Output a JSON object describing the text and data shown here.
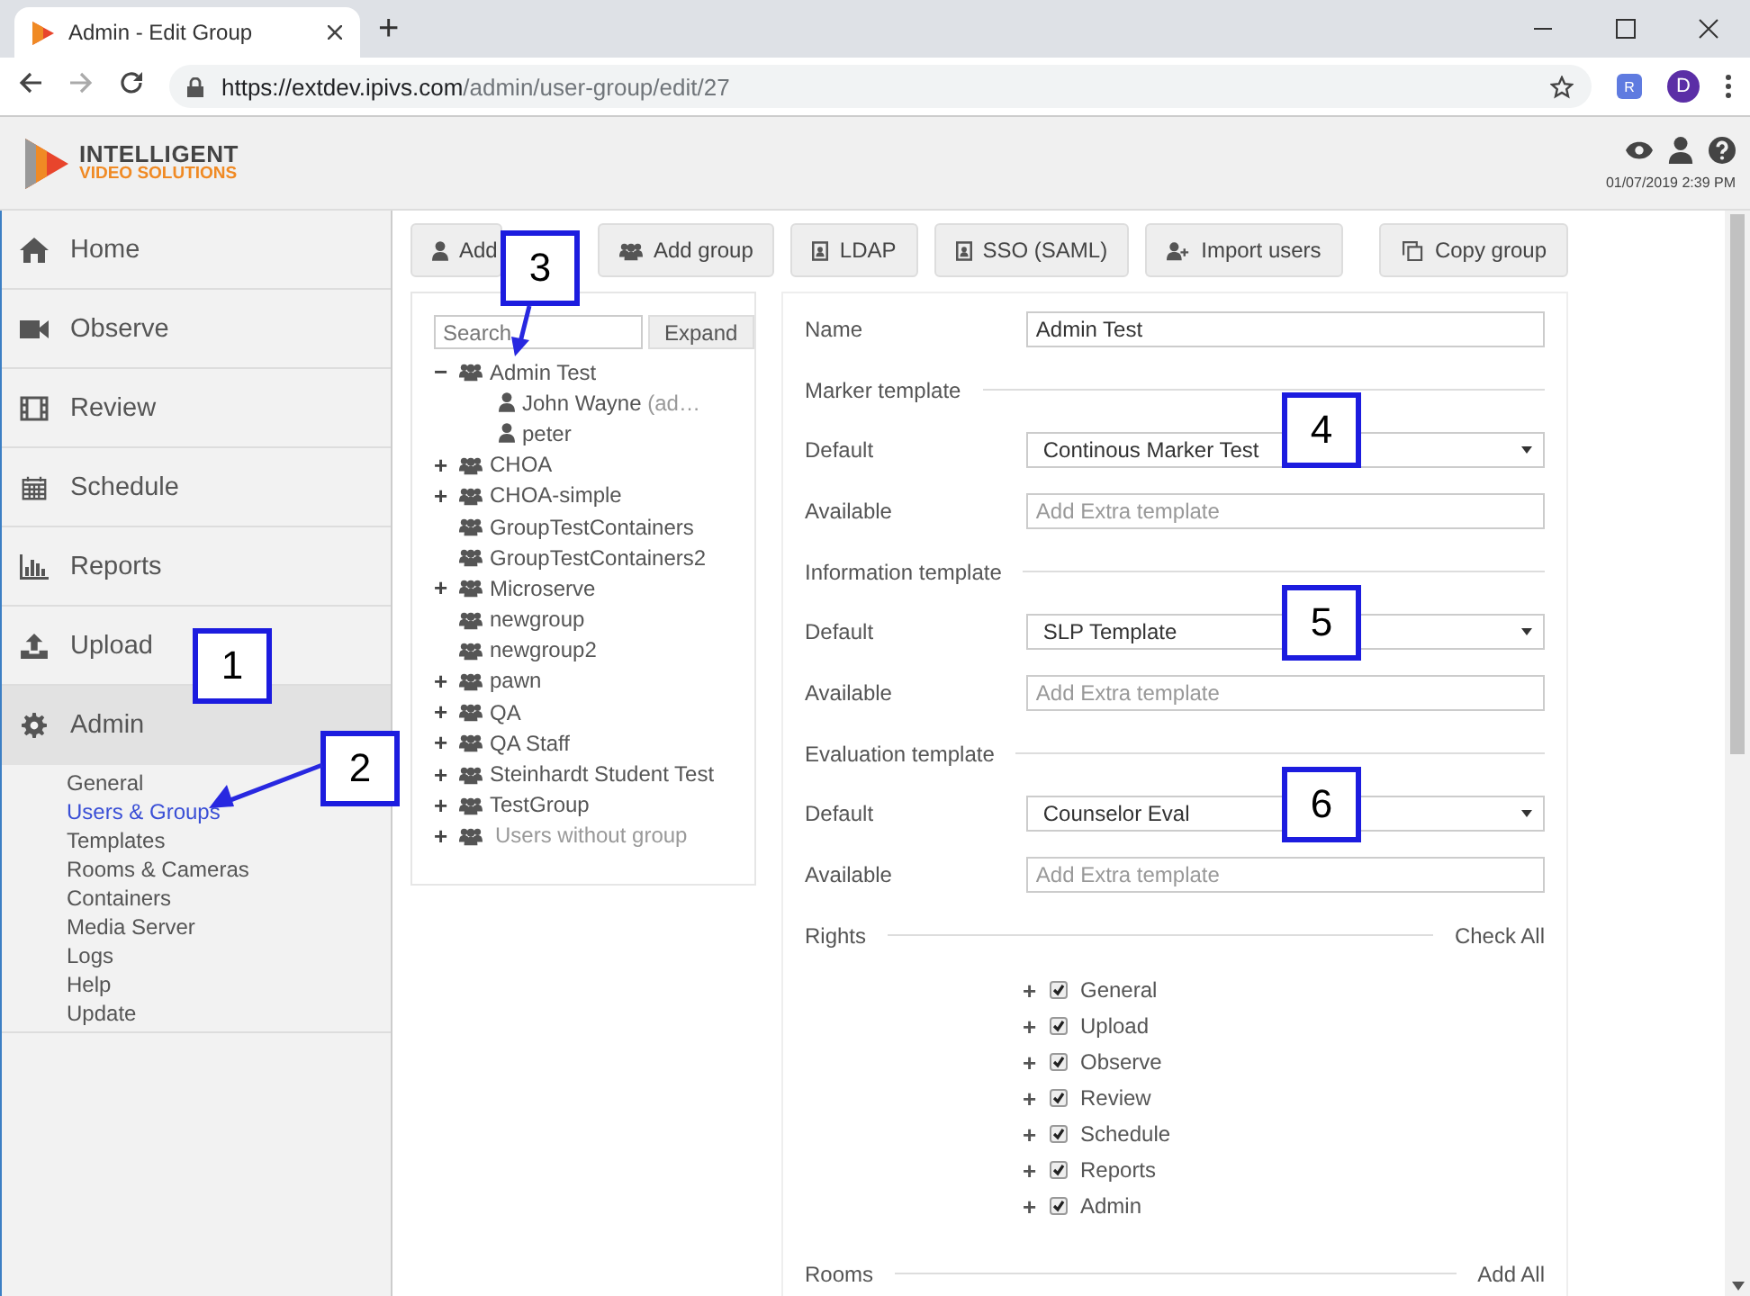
{
  "browser": {
    "tab_title": "Admin - Edit Group",
    "new_tab": "+",
    "url_host": "https://extdev.ipivs.com",
    "url_path": "/admin/user-group/edit/27",
    "extension_label": "R",
    "profile_initial": "D"
  },
  "header": {
    "logo_line1": "INTELLIGENT",
    "logo_line2": "VIDEO SOLUTIONS",
    "datetime": "01/07/2019 2:39 PM"
  },
  "sidebar": {
    "items": [
      {
        "label": "Home",
        "selected": false
      },
      {
        "label": "Observe",
        "selected": false
      },
      {
        "label": "Review",
        "selected": false
      },
      {
        "label": "Schedule",
        "selected": false
      },
      {
        "label": "Reports",
        "selected": false
      },
      {
        "label": "Upload",
        "selected": false
      },
      {
        "label": "Admin",
        "selected": true
      }
    ],
    "subitems": [
      {
        "label": "General",
        "selected": false
      },
      {
        "label": "Users & Groups",
        "selected": true
      },
      {
        "label": "Templates",
        "selected": false
      },
      {
        "label": "Rooms & Cameras",
        "selected": false
      },
      {
        "label": "Containers",
        "selected": false
      },
      {
        "label": "Media Server",
        "selected": false
      },
      {
        "label": "Logs",
        "selected": false
      },
      {
        "label": "Help",
        "selected": false
      },
      {
        "label": "Update",
        "selected": false
      }
    ]
  },
  "toolbar": {
    "buttons": [
      {
        "label": "Add"
      },
      {
        "label": "Add group"
      },
      {
        "label": "LDAP"
      },
      {
        "label": "SSO (SAML)"
      },
      {
        "label": "Import users"
      }
    ],
    "copy_button": {
      "label": "Copy group"
    }
  },
  "tree": {
    "search": {
      "placeholder": "Search"
    },
    "expand_button": "Expand",
    "nodes": [
      {
        "label": "Admin Test",
        "toggle": "−",
        "muted": false,
        "children": [
          {
            "label": "John Wayne",
            "note": "(ad…"
          },
          {
            "label": "peter"
          }
        ]
      },
      {
        "label": "CHOA",
        "toggle": "+",
        "muted": false
      },
      {
        "label": "CHOA-simple",
        "toggle": "+",
        "muted": false
      },
      {
        "label": "GroupTestContainers",
        "muted": false
      },
      {
        "label": "GroupTestContainers2",
        "muted": false
      },
      {
        "label": "Microserve",
        "toggle": "+",
        "muted": false
      },
      {
        "label": "newgroup",
        "muted": false
      },
      {
        "label": "newgroup2",
        "muted": false
      },
      {
        "label": "pawn",
        "toggle": "+",
        "muted": false
      },
      {
        "label": "QA",
        "toggle": "+",
        "muted": false
      },
      {
        "label": "QA Staff",
        "toggle": "+",
        "muted": false
      },
      {
        "label": "Steinhardt Student Test",
        "toggle": "+",
        "muted": false
      },
      {
        "label": "TestGroup",
        "toggle": "+",
        "muted": false
      },
      {
        "label": "Users without group",
        "toggle": "+",
        "muted": true
      }
    ]
  },
  "form": {
    "name_label": "Name",
    "name_value": "Admin Test",
    "templates": [
      {
        "title": "Marker template",
        "default_label": "Default",
        "default_value": "Continous Marker Test",
        "available_label": "Available",
        "available_placeholder": "Add Extra template"
      },
      {
        "title": "Information template",
        "default_label": "Default",
        "default_value": "SLP Template",
        "available_label": "Available",
        "available_placeholder": "Add Extra template"
      },
      {
        "title": "Evaluation template",
        "default_label": "Default",
        "default_value": "Counselor Eval",
        "available_label": "Available",
        "available_placeholder": "Add Extra template"
      }
    ],
    "rights": {
      "title": "Rights",
      "action": "Check All",
      "items": [
        {
          "toggle": "+",
          "label": "General",
          "checked": true
        },
        {
          "toggle": "+",
          "label": "Upload",
          "checked": true
        },
        {
          "toggle": "+",
          "label": "Observe",
          "checked": true
        },
        {
          "toggle": "+",
          "label": "Review",
          "checked": true
        },
        {
          "toggle": "+",
          "label": "Schedule",
          "checked": true
        },
        {
          "toggle": "+",
          "label": "Reports",
          "checked": true
        },
        {
          "toggle": "+",
          "label": "Admin",
          "checked": true
        }
      ]
    },
    "rooms": {
      "title": "Rooms",
      "action": "Add All"
    }
  },
  "callouts": [
    {
      "label": "1",
      "kind": "box"
    },
    {
      "label": "2",
      "kind": "arrow"
    },
    {
      "label": "3",
      "kind": "arrow"
    },
    {
      "label": "4",
      "kind": "box"
    },
    {
      "label": "5",
      "kind": "box"
    },
    {
      "label": "6",
      "kind": "box"
    }
  ]
}
